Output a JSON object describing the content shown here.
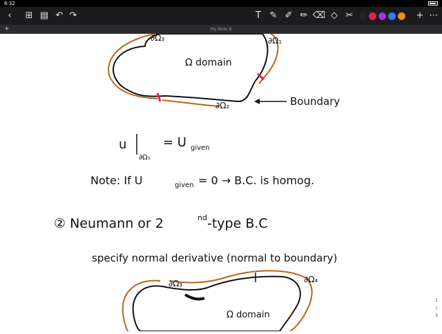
{
  "status": {
    "time": "6:32"
  },
  "toolbar": {
    "back_icon": "‹",
    "grid_icon": "⊞",
    "doc_icon": "▤",
    "undo_icon": "↶",
    "redo_icon": "↷",
    "text_icon": "T",
    "lasso_icon": "✎",
    "pen_icon": "✐",
    "highlighter_icon": "✏",
    "eraser_icon": "⌫",
    "shape_icon": "◇",
    "scissors_icon": "✂",
    "add_icon": "+",
    "more_icon": "⋯",
    "colors": [
      "#222222",
      "#e51c54",
      "#9b37d9",
      "#2f7cf6",
      "#ef8a1f"
    ]
  },
  "tab": {
    "plus": "+",
    "title": "My Note 8"
  },
  "note": {
    "omega1_top": "∂Ω₃",
    "omega1_right": "∂Ω₁",
    "domain1": "Ω domain",
    "boundary": "Boundary",
    "omega2": "∂Ω₂",
    "eq_u": "u",
    "eq_sub": "∂Ω₁",
    "eq_rhs": "= U",
    "eq_rhs_sub": "given",
    "note_line": "Note:  If  U",
    "note_sub": "given",
    "note_rest": "= 0  →  B.C.  is  homog.",
    "heading": "② Neumann  or  2",
    "heading_sup": "nd",
    "heading_rest": "-type  B.C",
    "specify": "specify  normal  derivative  (normal  to  boundary)",
    "omega3": "∂Ω₃",
    "omega4": "∂Ω₄",
    "domain2": "Ω domain"
  },
  "pages": {
    "current": "1",
    "sep": "/",
    "total": "3"
  }
}
